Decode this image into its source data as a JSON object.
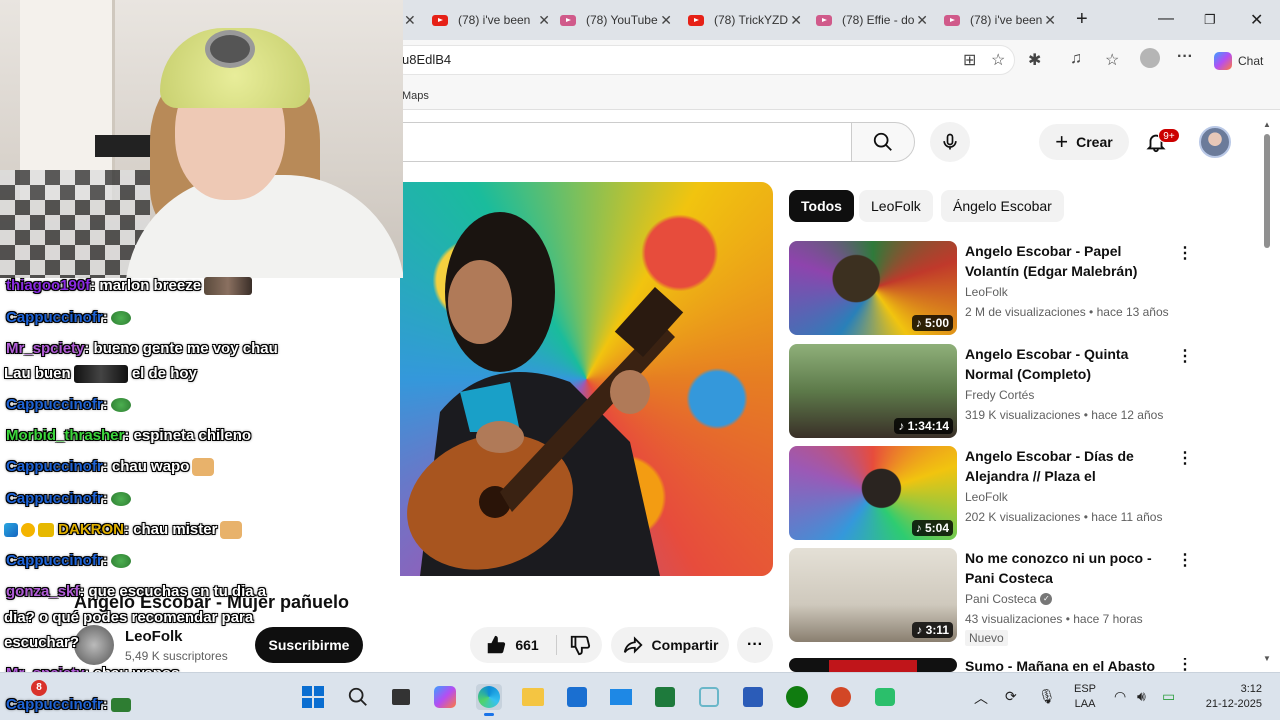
{
  "browser": {
    "tabs": [
      {
        "title": "(78) i've been",
        "icon": "youtube-icon"
      },
      {
        "title": "(78) YouTube",
        "icon": "youtube-icon"
      },
      {
        "title": "(78) TrickYZD",
        "icon": "youtube-icon"
      },
      {
        "title": "(78) Effie - do",
        "icon": "youtube-icon"
      },
      {
        "title": "(78) i've been",
        "icon": "youtube-icon"
      }
    ],
    "new_tab": "+",
    "url": "u8EdlB4",
    "bookmark": "Maps",
    "chat_label": "Chat"
  },
  "youtube": {
    "create_label": "Crear",
    "notifications_badge": "9+",
    "video": {
      "title": "Angelo Escobar - Mujer pañuelo",
      "channel": "LeoFolk",
      "subscribers": "5,49 K suscriptores",
      "subscribe_label": "Suscribirme",
      "likes": "661",
      "share_label": "Compartir",
      "more_label": "···"
    },
    "chips": [
      "Todos",
      "LeoFolk",
      "Ángelo Escobar"
    ],
    "recommended": [
      {
        "title": "Angelo Escobar - Papel Volantín (Edgar Malebrán)",
        "channel": "LeoFolk",
        "meta": "2 M de visualizaciones • hace 13 años",
        "duration": "5:00",
        "verified": false,
        "badge": ""
      },
      {
        "title": "Angelo Escobar - Quinta Normal (Completo)",
        "channel": "Fredy Cortés",
        "meta": "319 K visualizaciones • hace 12 años",
        "duration": "1:34:14",
        "verified": false,
        "badge": ""
      },
      {
        "title": "Angelo Escobar - Días de Alejandra // Plaza el descanso...",
        "channel": "LeoFolk",
        "meta": "202 K visualizaciones • hace 11 años",
        "duration": "5:04",
        "verified": false,
        "badge": ""
      },
      {
        "title": "No me conozco ni un poco - Pani Costeca",
        "channel": "Pani Costeca",
        "meta": "43 visualizaciones • hace 7 horas",
        "duration": "3:11",
        "verified": true,
        "badge": "Nuevo"
      },
      {
        "title": "Sumo - Mañana en el Abasto",
        "channel": "",
        "meta": "",
        "duration": "",
        "verified": false,
        "badge": ""
      }
    ]
  },
  "chat": [
    {
      "user": "thiagoo190f",
      "color": "#8a2be2",
      "msg": ": marlon breeze",
      "emote": "face"
    },
    {
      "user": "Cappuccinofr",
      "color": "#1e63d6",
      "msg": ":",
      "emote": "frog"
    },
    {
      "user": "Mr_spciety",
      "color": "#b05cd6",
      "msg": ": bueno gente me voy chau",
      "emote": ""
    },
    {
      "user": "Lau buen",
      "color": "#ffffff",
      "msg": "el de hoy",
      "emote": "dark"
    },
    {
      "user": "Cappuccinofr",
      "color": "#1e63d6",
      "msg": ":",
      "emote": "frog"
    },
    {
      "user": "Morbid_thrasher",
      "color": "#3cd63c",
      "msg": ": espineta chileno",
      "emote": ""
    },
    {
      "user": "Cappuccinofr",
      "color": "#1e63d6",
      "msg": ": chau wapo",
      "emote": "dog"
    },
    {
      "user": "Cappuccinofr",
      "color": "#1e63d6",
      "msg": ":",
      "emote": "frog"
    },
    {
      "user": "DAKRON",
      "color": "#e0b000",
      "msg": ": chau mister",
      "emote": "dog"
    },
    {
      "user": "Cappuccinofr",
      "color": "#1e63d6",
      "msg": ":",
      "emote": "frog"
    },
    {
      "user": "gonza_skf",
      "color": "#b05cd6",
      "msg": ": que escuchas en tu dia a",
      "emote": ""
    },
    {
      "user": "",
      "color": "#ffffff",
      "msg": "dia? o qué podes recomendar para",
      "emote": ""
    },
    {
      "user": "",
      "color": "#ffffff",
      "msg": "escuchar?",
      "emote": ""
    },
    {
      "user": "Mr_spciety",
      "color": "#b05cd6",
      "msg": ": chau wapos",
      "emote": ""
    },
    {
      "user": "Cappuccinofr",
      "color": "#1e63d6",
      "msg": ":",
      "emote": "frog"
    }
  ],
  "taskbar": {
    "notification_count": "8",
    "language": [
      "ESP",
      "LAA"
    ],
    "time": "3:12",
    "date": "21-12-2025"
  }
}
